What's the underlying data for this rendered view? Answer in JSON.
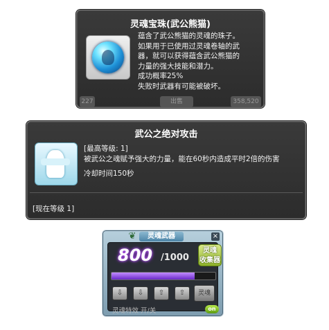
{
  "item_tooltip": {
    "title": "灵魂宝珠(武公熊猫)",
    "icon": "soul-orb-icon",
    "desc_lines": [
      "蕴含了武公熊猫的灵魂的珠子。",
      "如果用于已使用过灵魂卷轴的武",
      "器，就可以获得蕴含武公熊猫的",
      "力量的强大技能和潜力。",
      "成功概率25%",
      "失败时武器有可能被破坏。"
    ],
    "peek_left": "227",
    "peek_mid": "出售",
    "peek_right": "358,520"
  },
  "skill_tooltip": {
    "title": "武公之绝对攻击",
    "icon": "warrior-statue-icon",
    "max_level": "[最高等级: 1]",
    "desc": "被武公之魂赋予强大的力量，能在60秒内造成平时2倍的伤害",
    "cooldown": "冷却时间150秒",
    "current_level": "[现在等级 1]"
  },
  "soul_panel": {
    "title": "灵魂武器",
    "close": "×",
    "count": "800",
    "max": "/1000",
    "collector_label_1": "灵魂",
    "collector_label_2": "收集器",
    "progress": 0.8,
    "slots": [
      "⇩",
      "⇩",
      "⇧",
      "⇧"
    ],
    "end_slot": "灵魂",
    "effect_label": "灵魂特效 开/关",
    "toggle": "on",
    "accent_purple": "#8a2ad8",
    "accent_green": "#8fb32a"
  }
}
